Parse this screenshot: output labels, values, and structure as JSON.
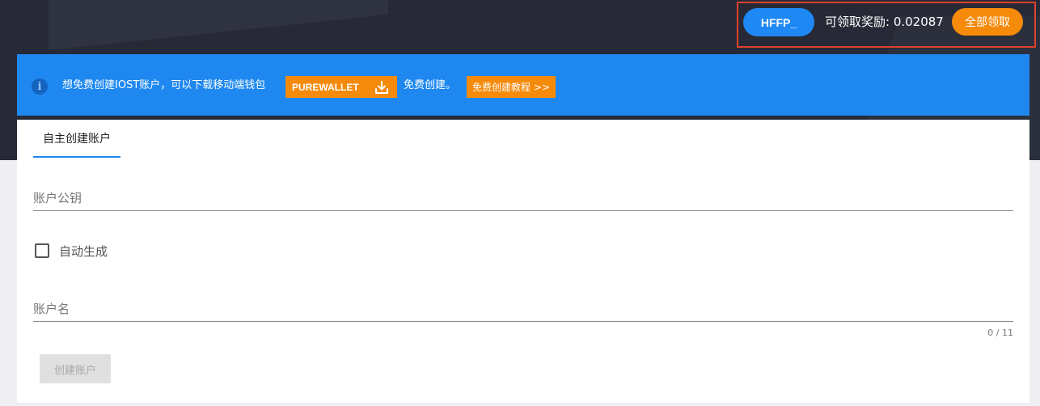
{
  "header": {
    "user_label": "HFFP_",
    "reward_label": "可领取奖励: 0.02087",
    "claim_all_label": "全部领取"
  },
  "banner": {
    "info_icon": "info-icon",
    "text_before": "想免费创建IOST账户，可以下载移动端钱包",
    "wallet_button_label": "PUREWALLET",
    "wallet_button_icon": "download-icon",
    "text_after": "免费创建。",
    "tutorial_button_label": "免费创建教程 >>"
  },
  "form": {
    "tab_label": "自主创建账户",
    "public_key_placeholder": "账户公钥",
    "auto_generate_label": "自动生成",
    "account_name_placeholder": "账户名",
    "char_counter": "0 / 11",
    "create_button_label": "创建账户"
  },
  "colors": {
    "accent_blue": "#1e88f0",
    "accent_orange": "#f58a0b",
    "header_dark": "#272a36"
  }
}
